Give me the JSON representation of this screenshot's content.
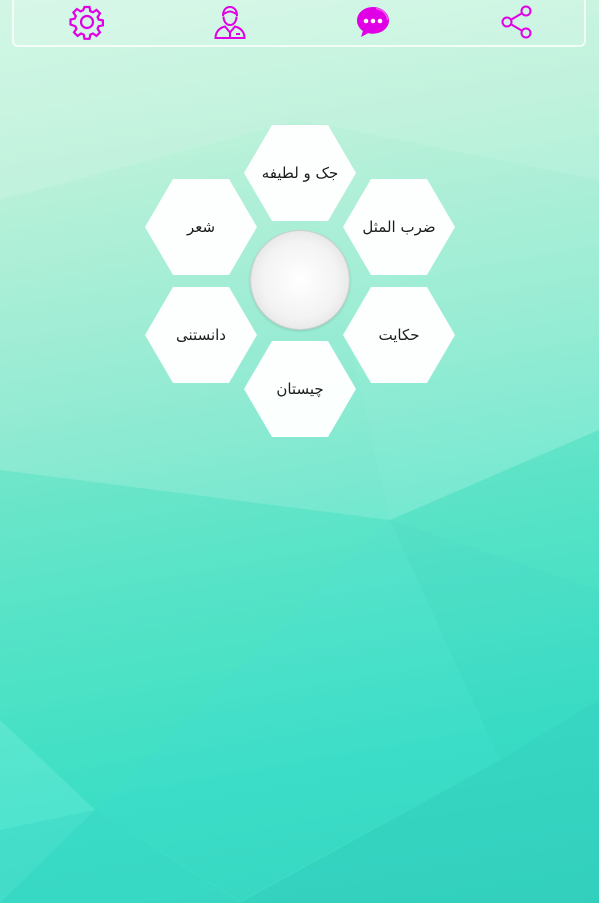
{
  "colors": {
    "accent": "#e100e6",
    "hex_fill": "#ffffff"
  },
  "toolbar": {
    "items": [
      {
        "icon": "gear-icon"
      },
      {
        "icon": "user-icon"
      },
      {
        "icon": "chat-bubble-icon"
      },
      {
        "icon": "share-icon"
      }
    ]
  },
  "menu": {
    "items": [
      {
        "label": "جک و لطیفه"
      },
      {
        "label": "ضرب المثل"
      },
      {
        "label": "شعر"
      },
      {
        "label": "حکایت"
      },
      {
        "label": "دانستنی"
      },
      {
        "label": "چیستان"
      }
    ]
  }
}
